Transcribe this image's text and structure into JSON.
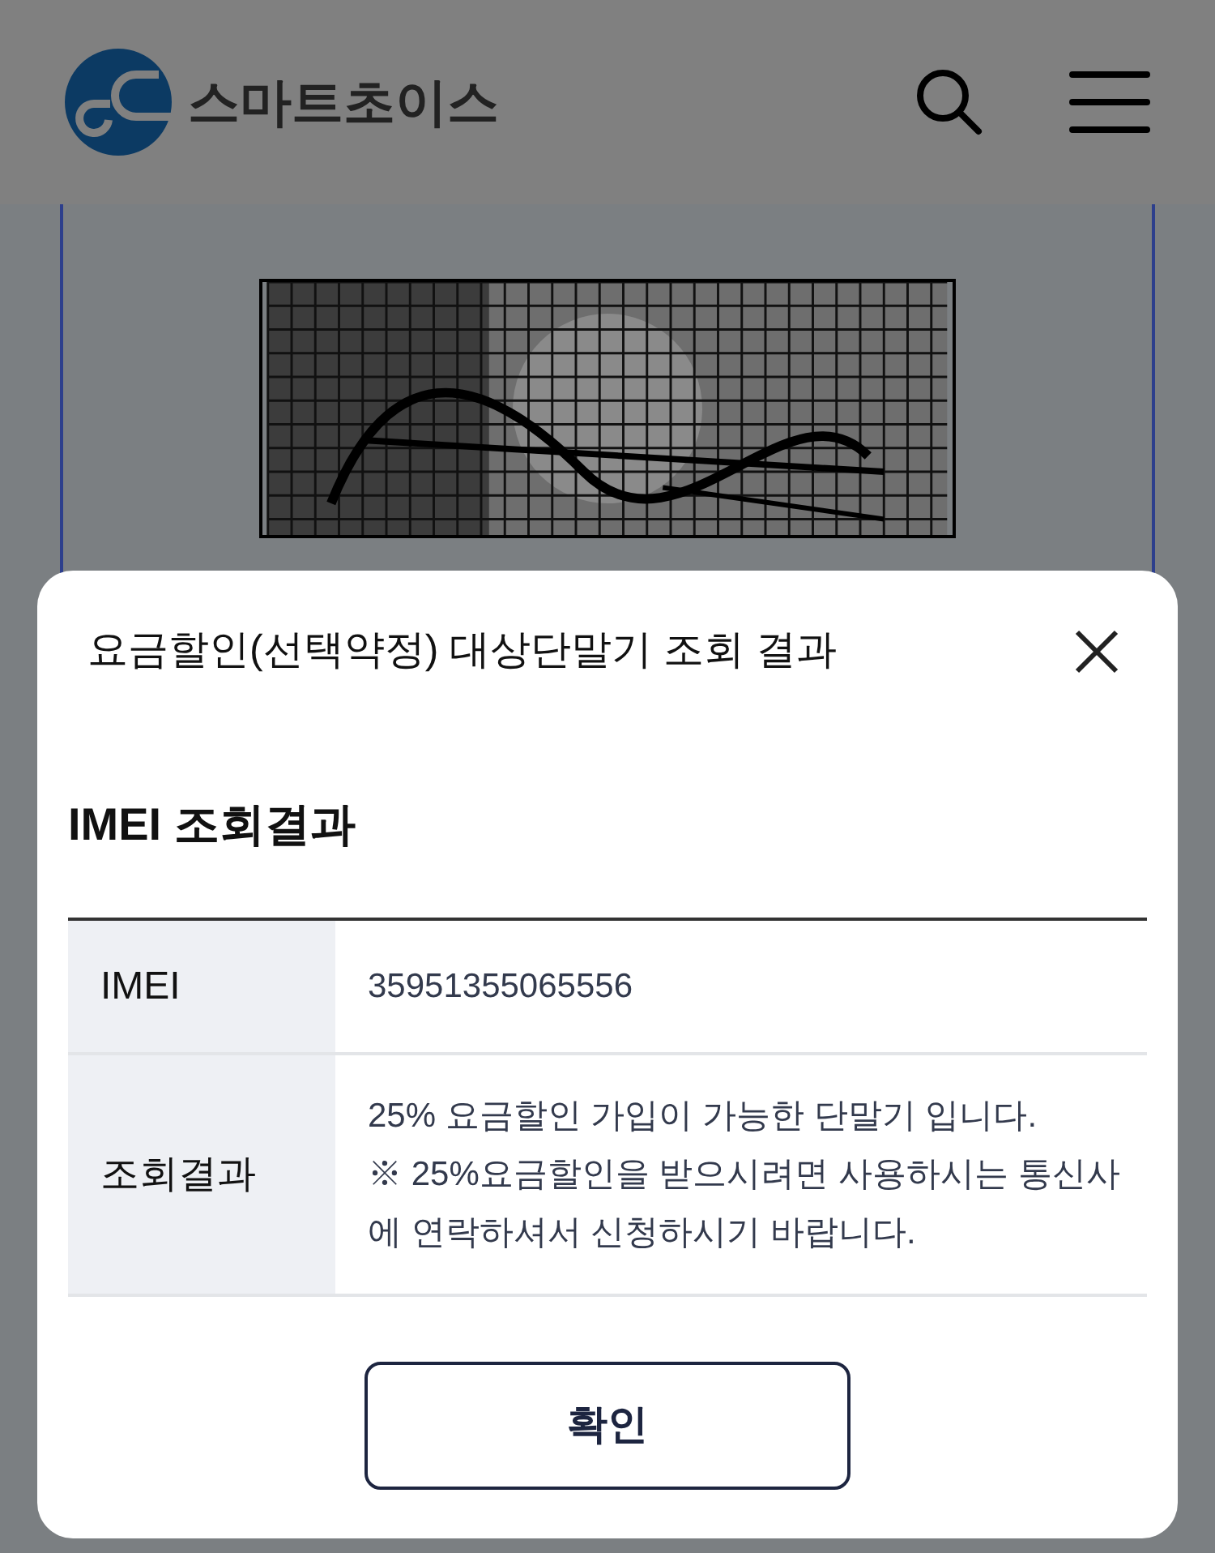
{
  "header": {
    "logo_text": "스마트초이스"
  },
  "modal": {
    "title": "요금할인(선택약정) 대상단말기 조회 결과",
    "section_title": "IMEI 조회결과",
    "rows": [
      {
        "label": "IMEI",
        "value": "35951355065556"
      },
      {
        "label": "조회결과",
        "value": "25% 요금할인 가입이 가능한 단말기 입니다.\n※ 25%요금할인을 받으시려면 사용하시는 통신사에 연락하셔서 신청하시기 바랍니다."
      }
    ],
    "confirm_button": "확인"
  }
}
